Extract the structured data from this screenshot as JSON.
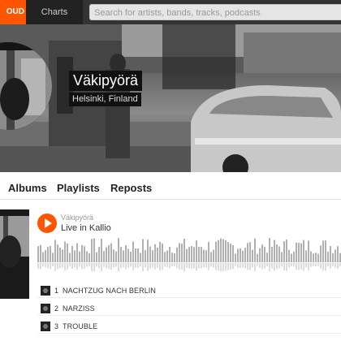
{
  "header": {
    "logo_text": "OUD",
    "nav_charts": "Charts",
    "search_placeholder": "Search for artists, bands, tracks, podcasts"
  },
  "profile": {
    "name": "Väkipyörä",
    "location": "Helsinki, Finland"
  },
  "tabs": [
    "Albums",
    "Playlists",
    "Reposts"
  ],
  "track": {
    "artist": "Väkipyörä",
    "title": "Live in Kallio"
  },
  "tracklist": [
    {
      "num": "1",
      "name": "NACHTZUG NACH BERLIN"
    },
    {
      "num": "2",
      "name": "NARZISS"
    },
    {
      "num": "3",
      "name": "TROUBLE"
    }
  ],
  "colors": {
    "accent": "#ff5500",
    "topbar": "#333333"
  }
}
